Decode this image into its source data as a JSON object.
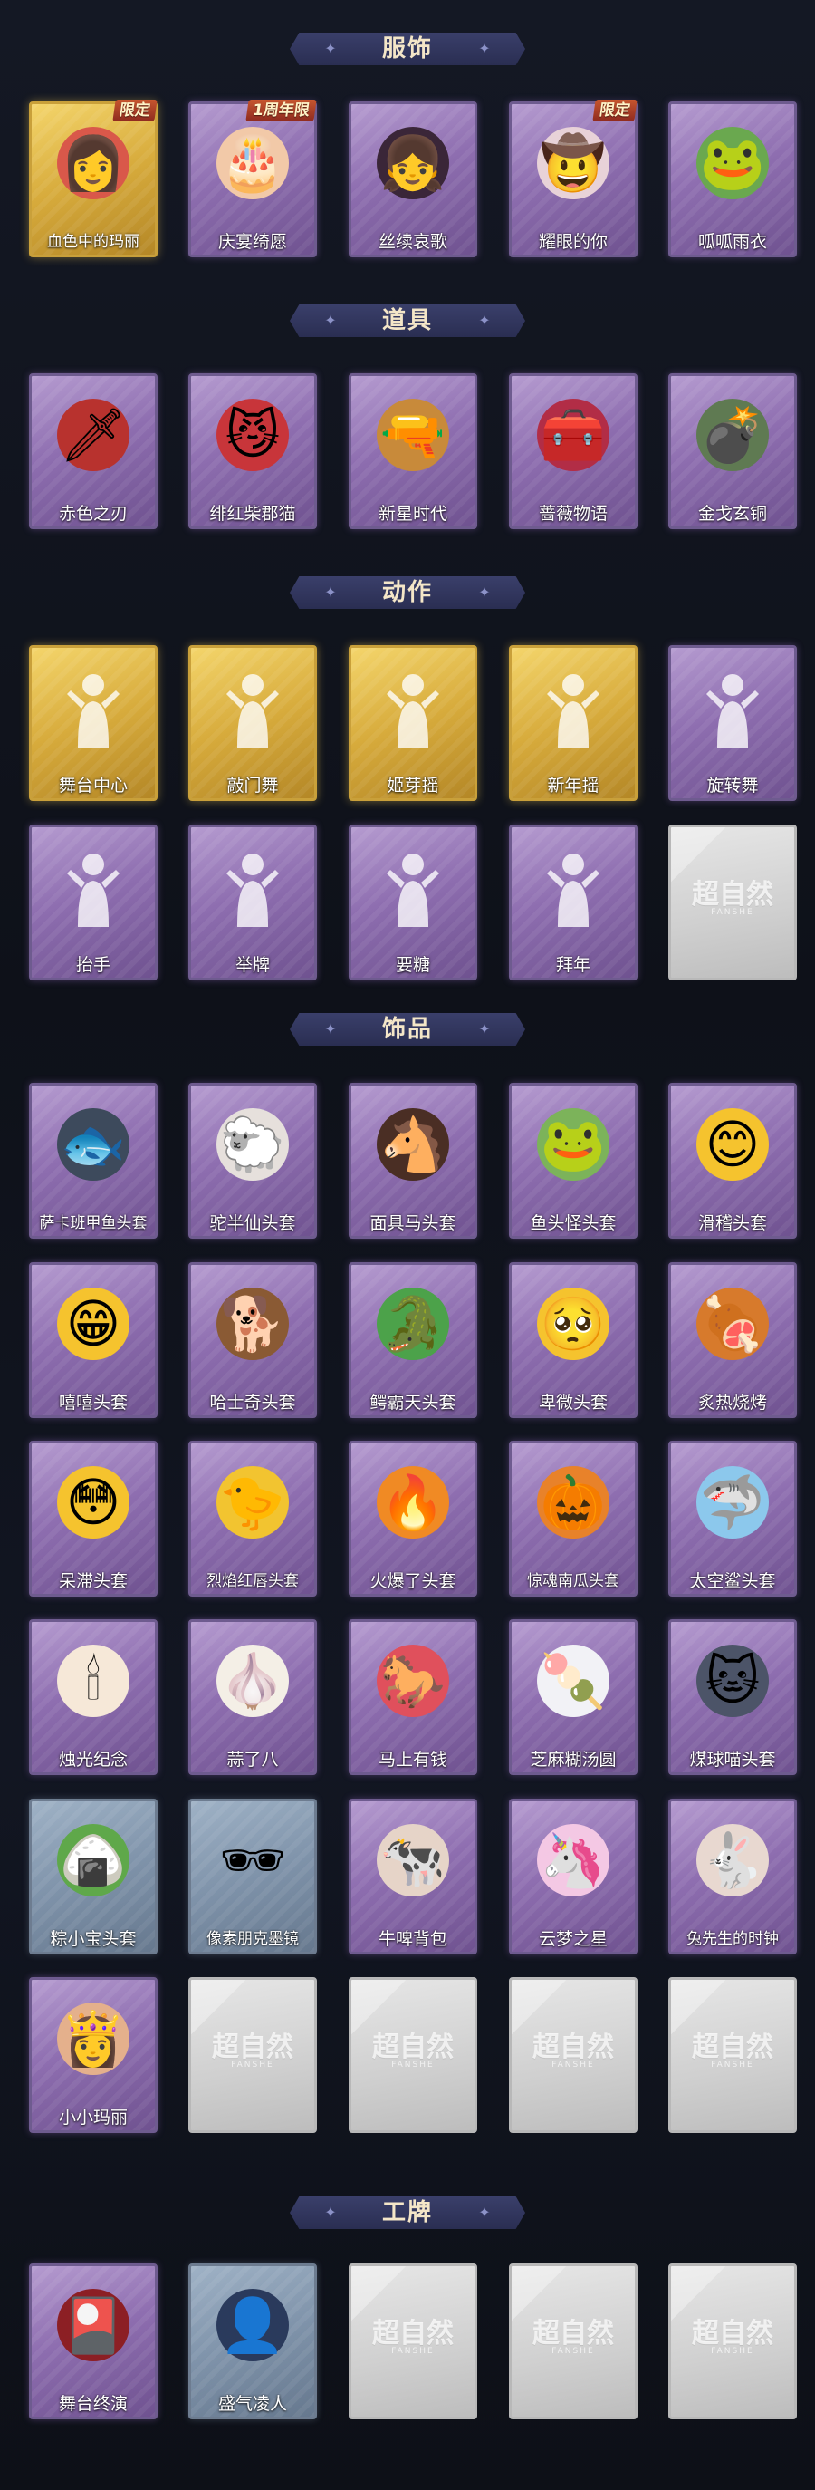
{
  "sections": [
    {
      "id": "costumes",
      "title": "服饰",
      "rows": [
        [
          {
            "label": "血色中的玛丽",
            "tier": "gold",
            "badge": "限定",
            "icon": "red-hair-girl-icon",
            "glyph": "👩",
            "blob": "#d9584a"
          },
          {
            "label": "庆宴绮愿",
            "tier": "purple",
            "badge": "1周年限",
            "icon": "cake-girl-icon",
            "glyph": "🎂",
            "blob": "#f2c9a8"
          },
          {
            "label": "丝续哀歌",
            "tier": "purple",
            "badge": "",
            "icon": "gothic-doll-icon",
            "glyph": "👧",
            "blob": "#3a2638"
          },
          {
            "label": "耀眼的你",
            "tier": "purple",
            "badge": "限定",
            "icon": "cowgirl-icon",
            "glyph": "🤠",
            "blob": "#e8d2d8"
          },
          {
            "label": "呱呱雨衣",
            "tier": "purple",
            "badge": "",
            "icon": "frog-raincoat-icon",
            "glyph": "🐸",
            "blob": "#6aa84f"
          }
        ]
      ]
    },
    {
      "id": "props",
      "title": "道具",
      "rows": [
        [
          {
            "label": "赤色之刃",
            "tier": "purple",
            "badge": "",
            "icon": "red-sword-icon",
            "glyph": "🗡",
            "blob": "#b8322e"
          },
          {
            "label": "绯红柴郡猫",
            "tier": "purple",
            "badge": "",
            "icon": "cheshire-cat-icon",
            "glyph": "😼",
            "blob": "#c8353a"
          },
          {
            "label": "新星时代",
            "tier": "purple",
            "badge": "",
            "icon": "revolver-icon",
            "glyph": "🔫",
            "blob": "#c88a3a"
          },
          {
            "label": "蔷薇物语",
            "tier": "purple",
            "badge": "",
            "icon": "medkit-icon",
            "glyph": "🧰",
            "blob": "#b22d46"
          },
          {
            "label": "金戈玄铜",
            "tier": "purple",
            "badge": "",
            "icon": "grenade-icon",
            "glyph": "💣",
            "blob": "#5f7a52"
          }
        ]
      ]
    },
    {
      "id": "emotes",
      "title": "动作",
      "rows": [
        [
          {
            "label": "舞台中心",
            "tier": "gold",
            "badge": "",
            "icon": "stage-pose-icon",
            "glyph": "",
            "blob": ""
          },
          {
            "label": "敲门舞",
            "tier": "gold",
            "badge": "",
            "icon": "knock-dance-icon",
            "glyph": "",
            "blob": ""
          },
          {
            "label": "姬芽摇",
            "tier": "gold",
            "badge": "",
            "icon": "sprout-shake-icon",
            "glyph": "",
            "blob": ""
          },
          {
            "label": "新年摇",
            "tier": "gold",
            "badge": "",
            "icon": "new-year-shake-icon",
            "glyph": "",
            "blob": ""
          },
          {
            "label": "旋转舞",
            "tier": "purple",
            "badge": "",
            "icon": "spin-dance-icon",
            "glyph": "",
            "blob": ""
          }
        ],
        [
          {
            "label": "抬手",
            "tier": "purple",
            "badge": "",
            "icon": "raise-hand-icon",
            "glyph": "",
            "blob": ""
          },
          {
            "label": "举牌",
            "tier": "purple",
            "badge": "",
            "icon": "hold-sign-icon",
            "glyph": "",
            "blob": ""
          },
          {
            "label": "要糖",
            "tier": "purple",
            "badge": "",
            "icon": "ask-candy-icon",
            "glyph": "",
            "blob": ""
          },
          {
            "label": "拜年",
            "tier": "purple",
            "badge": "",
            "icon": "new-year-greeting-icon",
            "glyph": "",
            "blob": ""
          },
          {
            "label": "",
            "tier": "locked",
            "badge": "",
            "icon": "placeholder-icon",
            "glyph": "",
            "blob": ""
          }
        ]
      ]
    },
    {
      "id": "accessories",
      "title": "饰品",
      "rows": [
        [
          {
            "label": "萨卡班甲鱼头套",
            "tier": "purple",
            "badge": "",
            "icon": "fish-head-icon",
            "glyph": "🐟",
            "blob": "#3d4a5c"
          },
          {
            "label": "驼半仙头套",
            "tier": "purple",
            "badge": "",
            "icon": "alpaca-head-icon",
            "glyph": "🐑",
            "blob": "#e6e0dc"
          },
          {
            "label": "面具马头套",
            "tier": "purple",
            "badge": "",
            "icon": "horse-head-icon",
            "glyph": "🐴",
            "blob": "#4a2e24"
          },
          {
            "label": "鱼头怪头套",
            "tier": "purple",
            "badge": "",
            "icon": "fish-monster-head-icon",
            "glyph": "🐸",
            "blob": "#7cb35a"
          },
          {
            "label": "滑稽头套",
            "tier": "purple",
            "badge": "",
            "icon": "funny-face-icon",
            "glyph": "😊",
            "blob": "#f5c32e"
          }
        ],
        [
          {
            "label": "嘻嘻头套",
            "tier": "purple",
            "badge": "",
            "icon": "grin-face-icon",
            "glyph": "😁",
            "blob": "#f5c32e"
          },
          {
            "label": "哈士奇头套",
            "tier": "purple",
            "badge": "",
            "icon": "husky-head-icon",
            "glyph": "🐕",
            "blob": "#8a5a34"
          },
          {
            "label": "鳄霸天头套",
            "tier": "purple",
            "badge": "",
            "icon": "crocodile-head-icon",
            "glyph": "🐊",
            "blob": "#4ca24a"
          },
          {
            "label": "卑微头套",
            "tier": "purple",
            "badge": "",
            "icon": "humble-face-icon",
            "glyph": "🥺",
            "blob": "#f5c32e"
          },
          {
            "label": "炙热烧烤",
            "tier": "purple",
            "badge": "",
            "icon": "bbq-meat-icon",
            "glyph": "🍖",
            "blob": "#d77a2c"
          }
        ],
        [
          {
            "label": "呆滞头套",
            "tier": "purple",
            "badge": "",
            "icon": "dazed-face-icon",
            "glyph": "😳",
            "blob": "#f5c32e"
          },
          {
            "label": "烈焰红唇头套",
            "tier": "purple",
            "badge": "",
            "icon": "pikachu-head-icon",
            "glyph": "🐤",
            "blob": "#f2c430"
          },
          {
            "label": "火爆了头套",
            "tier": "purple",
            "badge": "",
            "icon": "fire-spirit-icon",
            "glyph": "🔥",
            "blob": "#f08a24"
          },
          {
            "label": "惊魂南瓜头套",
            "tier": "purple",
            "badge": "",
            "icon": "pumpkin-head-icon",
            "glyph": "🎃",
            "blob": "#e8822a"
          },
          {
            "label": "太空鲨头套",
            "tier": "purple",
            "badge": "",
            "icon": "space-shark-icon",
            "glyph": "🦈",
            "blob": "#8cc8ec"
          }
        ],
        [
          {
            "label": "烛光纪念",
            "tier": "purple",
            "badge": "",
            "icon": "candle-icon",
            "glyph": "🕯",
            "blob": "#f6e8d8"
          },
          {
            "label": "蒜了八",
            "tier": "purple",
            "badge": "",
            "icon": "garlic-icon",
            "glyph": "🧄",
            "blob": "#f4efe6"
          },
          {
            "label": "马上有钱",
            "tier": "purple",
            "badge": "",
            "icon": "money-horse-icon",
            "glyph": "🐎",
            "blob": "#e0505c"
          },
          {
            "label": "芝麻糊汤圆",
            "tier": "purple",
            "badge": "",
            "icon": "rice-ball-icon",
            "glyph": "🍡",
            "blob": "#f2f2f6"
          },
          {
            "label": "煤球喵头套",
            "tier": "purple",
            "badge": "",
            "icon": "coal-cat-icon",
            "glyph": "🐱",
            "blob": "#4c5468"
          }
        ],
        [
          {
            "label": "粽小宝头套",
            "tier": "blue",
            "badge": "",
            "icon": "zongzi-icon",
            "glyph": "🍙",
            "blob": "#5fa84a"
          },
          {
            "label": "像素朋克墨镜",
            "tier": "blue",
            "badge": "",
            "icon": "pixel-sunglasses-icon",
            "glyph": "🕶",
            "blob": ""
          },
          {
            "label": "牛啤背包",
            "tier": "purple",
            "badge": "",
            "icon": "cow-backpack-icon",
            "glyph": "🐄",
            "blob": "#e6d4c8"
          },
          {
            "label": "云梦之星",
            "tier": "purple",
            "badge": "",
            "icon": "unicorn-cloud-icon",
            "glyph": "🦄",
            "blob": "#f4c8e4"
          },
          {
            "label": "兔先生的时钟",
            "tier": "purple",
            "badge": "",
            "icon": "rabbit-clock-icon",
            "glyph": "🐇",
            "blob": "#e8d8d0"
          }
        ],
        [
          {
            "label": "小小玛丽",
            "tier": "purple",
            "badge": "",
            "icon": "little-mary-icon",
            "glyph": "👸",
            "blob": "#e4b08c"
          },
          {
            "label": "",
            "tier": "locked",
            "badge": "",
            "icon": "placeholder-icon",
            "glyph": "",
            "blob": ""
          },
          {
            "label": "",
            "tier": "locked",
            "badge": "",
            "icon": "placeholder-icon",
            "glyph": "",
            "blob": ""
          },
          {
            "label": "",
            "tier": "locked",
            "badge": "",
            "icon": "placeholder-icon",
            "glyph": "",
            "blob": ""
          },
          {
            "label": "",
            "tier": "locked",
            "badge": "",
            "icon": "placeholder-icon",
            "glyph": "",
            "blob": ""
          }
        ]
      ]
    },
    {
      "id": "nameplates",
      "title": "工牌",
      "rows": [
        [
          {
            "label": "舞台终演",
            "tier": "purple",
            "badge": "",
            "icon": "stage-card-icon",
            "glyph": "🎴",
            "blob": "#8c1f24"
          },
          {
            "label": "盛气凌人",
            "tier": "blue",
            "badge": "",
            "icon": "silhouette-card-icon",
            "glyph": "👤",
            "blob": "#2a3a5c"
          },
          {
            "label": "",
            "tier": "locked",
            "badge": "",
            "icon": "placeholder-icon",
            "glyph": "",
            "blob": ""
          },
          {
            "label": "",
            "tier": "locked",
            "badge": "",
            "icon": "placeholder-icon",
            "glyph": "",
            "blob": ""
          },
          {
            "label": "",
            "tier": "locked",
            "badge": "",
            "icon": "placeholder-icon",
            "glyph": "",
            "blob": ""
          }
        ]
      ]
    }
  ],
  "placeholder": {
    "title": "超自然",
    "subtitle": "FANSHE"
  },
  "colors": {
    "background": "#10131d",
    "header": "#2a2e52",
    "header_text": "#f4e6c8"
  }
}
